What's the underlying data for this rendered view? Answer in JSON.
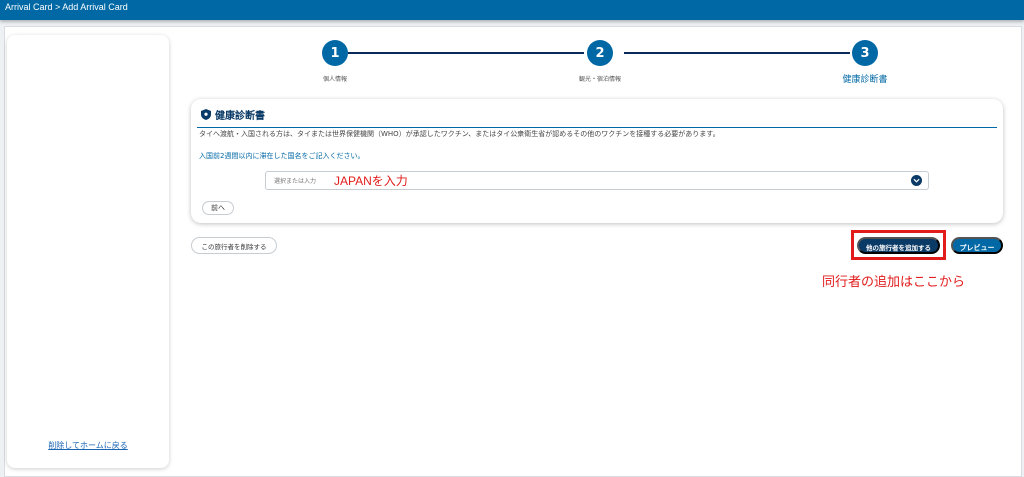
{
  "header": {
    "breadcrumb": "Arrival Card > Add Arrival Card"
  },
  "sidebar": {
    "home_link": "削除してホームに戻る"
  },
  "stepper": {
    "steps": [
      {
        "number": "1",
        "label": "個人情報"
      },
      {
        "number": "2",
        "label": "観光・宿泊情報"
      },
      {
        "number": "3",
        "label": "健康診断書"
      }
    ]
  },
  "health_card": {
    "title": "健康診断書",
    "notice": "タイへ渡航・入国される方は、タイまたは世界保健機関（WHO）が承認したワクチン、またはタイ公衆衛生省が認めるその他のワクチンを接種する必要があります。",
    "country_label": "入国前2週間以内に滞在した国名をご記入ください。",
    "country_select": {
      "placeholder": "選択または入力",
      "value": ""
    },
    "prev_button": "前へ"
  },
  "actions": {
    "delete_traveler": "この旅行者を削除する",
    "add_traveler": "他の旅行者を追加する",
    "preview": "プレビュー"
  },
  "annotations": {
    "input_hint": "JAPANを入力",
    "add_hint": "同行者の追加はここから"
  },
  "colors": {
    "primary": "#0068a5",
    "dark": "#0a3a66",
    "annotation": "#e21b1b"
  }
}
